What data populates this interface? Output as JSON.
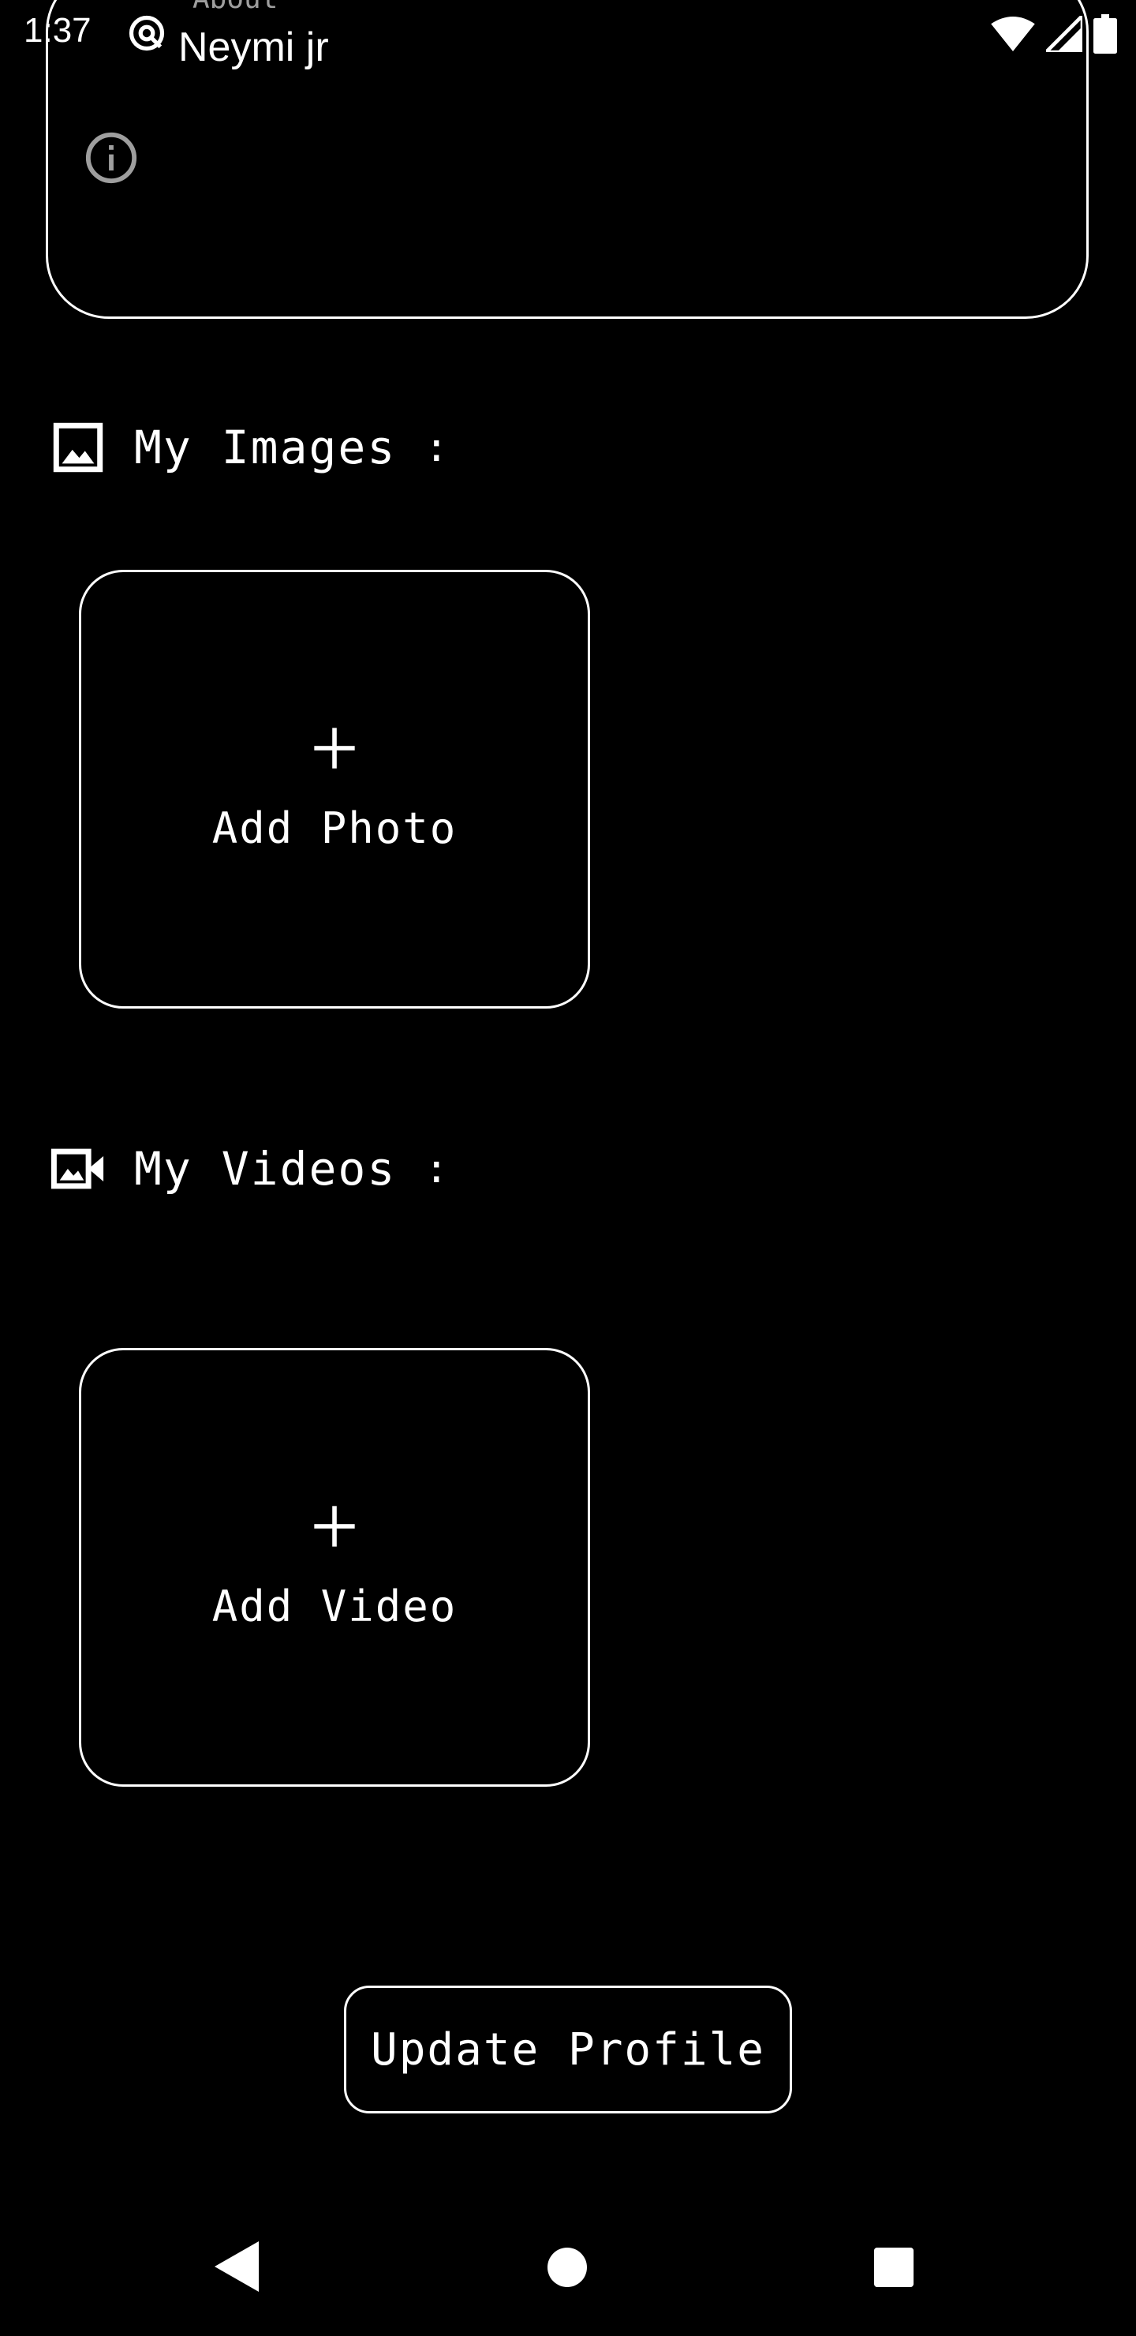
{
  "status_bar": {
    "time": "1:37"
  },
  "about": {
    "label": "About",
    "value": "Neymi jr"
  },
  "images_section": {
    "title": "My Images",
    "colon": ":",
    "add_label": "Add Photo"
  },
  "videos_section": {
    "title": "My Videos",
    "colon": ":",
    "add_label": "Add Video"
  },
  "update_button": {
    "label": "Update Profile"
  },
  "icons": {
    "status_app": "at-sign-icon",
    "wifi": "wifi-icon",
    "signal": "cellular-signal-icon",
    "battery": "battery-icon",
    "info": "info-icon",
    "image": "image-icon",
    "video": "video-camera-icon",
    "plus": "plus-icon",
    "back": "back-triangle-icon",
    "home": "home-circle-icon",
    "recent": "recent-apps-square-icon"
  },
  "colors": {
    "background": "#000000",
    "foreground": "#ffffff",
    "muted": "#9e9e9e"
  }
}
